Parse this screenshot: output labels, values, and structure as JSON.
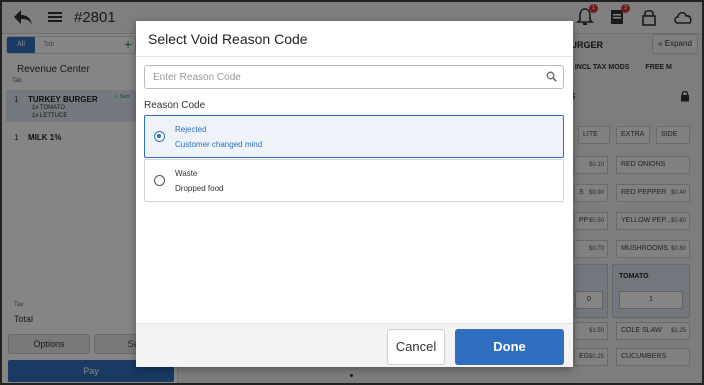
{
  "header": {
    "order_number": "#2801",
    "notification_badge": "1",
    "tickets_badge": "3"
  },
  "left_panel": {
    "tab_all": "All",
    "tab_tab": "Tab",
    "revenue_center": "Revenue Center",
    "revenue_sub": "Tab",
    "items": [
      {
        "qty": "1",
        "name": "TURKEY BURGER",
        "status": "✓ Sent",
        "modifiers": [
          "1x TOMATO",
          "1x LETTUCE"
        ]
      },
      {
        "qty": "1",
        "name": "MILK 1%"
      }
    ],
    "tax_label": "Tax",
    "total_label": "Total",
    "options_label": "Options",
    "second_button_label": "Se",
    "pay_label": "Pay"
  },
  "right_panel": {
    "title": "BURGER",
    "expand_label": "Expand",
    "tabs": [
      "S ●",
      "INCL TAX MODS",
      "FREE M"
    ],
    "section_label": "S",
    "quick_mods": [
      "LITE",
      "EXTRA",
      "SIDE"
    ],
    "mods": [
      {
        "name": "",
        "price": "$0.10"
      },
      {
        "name": "RED ONIONS",
        "price": ""
      },
      {
        "name": "S",
        "price": "$0.90"
      },
      {
        "name": "RED PEPPER",
        "price": "$0.40"
      },
      {
        "name": "PP",
        "price": "$0.50"
      },
      {
        "name": "YELLOW PEP...",
        "price": "$0.60"
      },
      {
        "name": "",
        "price": "$0.70"
      },
      {
        "name": "MUSHROOMS",
        "price": "$0.80"
      },
      {
        "name": "",
        "price": "$1.50"
      },
      {
        "name": "COLE SLAW",
        "price": "$1.25"
      },
      {
        "name": "EG",
        "price": "$0.25"
      },
      {
        "name": "CUCUMBERS",
        "price": ""
      }
    ],
    "tomato_label": "TOMATO",
    "tomato_qty": "1",
    "left_box_qty": "0"
  },
  "modal": {
    "title": "Select Void Reason Code",
    "search_placeholder": "Enter Reason Code",
    "search_value": "",
    "section_label": "Reason Code",
    "options": [
      {
        "title": "Rejected",
        "description": "Customer changed mind",
        "selected": true
      },
      {
        "title": "Waste",
        "description": "Dropped food",
        "selected": false
      }
    ],
    "cancel_label": "Cancel",
    "done_label": "Done"
  },
  "colors": {
    "accent": "#2f6fbf",
    "selected_bg": "#eef3fa",
    "badge": "#e03131"
  }
}
